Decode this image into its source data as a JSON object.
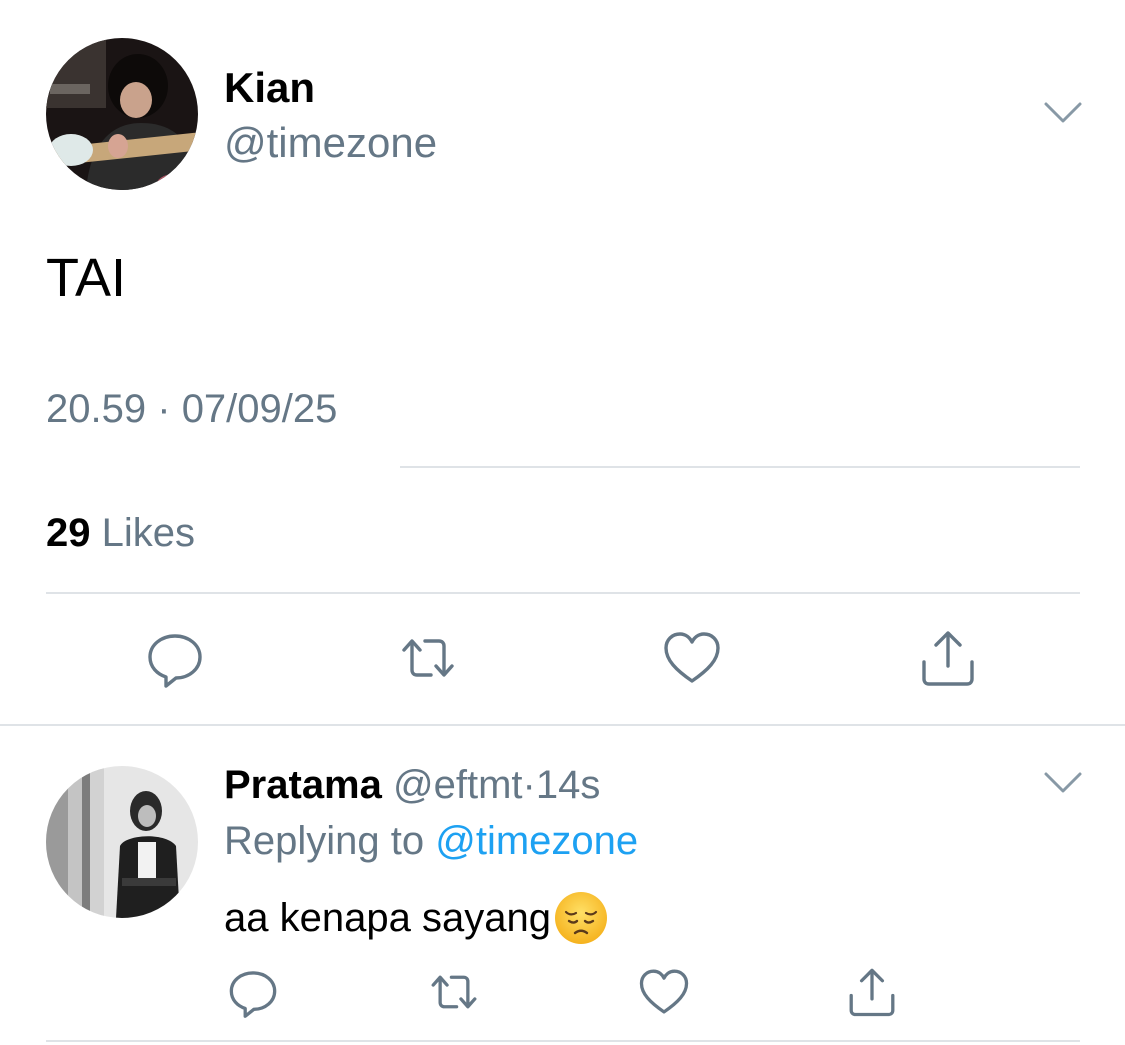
{
  "colors": {
    "text_primary": "#000000",
    "text_secondary": "#657786",
    "link": "#1da1f2",
    "divider": "#dfe3e7",
    "icon": "#657786"
  },
  "main_tweet": {
    "avatar_icon": "user-avatar",
    "display_name": "Kian",
    "handle": "@timezone",
    "menu_icon": "chevron-down-icon",
    "text": "TAI",
    "time": "20.59",
    "separator": "·",
    "date": "07/09/25",
    "likes_count": "29",
    "likes_label": "Likes",
    "actions": [
      {
        "name": "reply",
        "icon": "comment-icon"
      },
      {
        "name": "retweet",
        "icon": "retweet-icon"
      },
      {
        "name": "like",
        "icon": "heart-icon"
      },
      {
        "name": "share",
        "icon": "share-icon"
      }
    ]
  },
  "reply_tweet": {
    "avatar_icon": "user-avatar",
    "display_name": "Pratama",
    "handle": "@eftmt",
    "separator": "·",
    "age": "14s",
    "menu_icon": "chevron-down-icon",
    "replying_label": "Replying to",
    "replying_mention": "@timezone",
    "text": "aa kenapa sayang",
    "emoji_icon": "pensive-face-emoji",
    "actions": [
      {
        "name": "reply",
        "icon": "comment-icon"
      },
      {
        "name": "retweet",
        "icon": "retweet-icon"
      },
      {
        "name": "like",
        "icon": "heart-icon"
      },
      {
        "name": "share",
        "icon": "share-icon"
      }
    ]
  }
}
